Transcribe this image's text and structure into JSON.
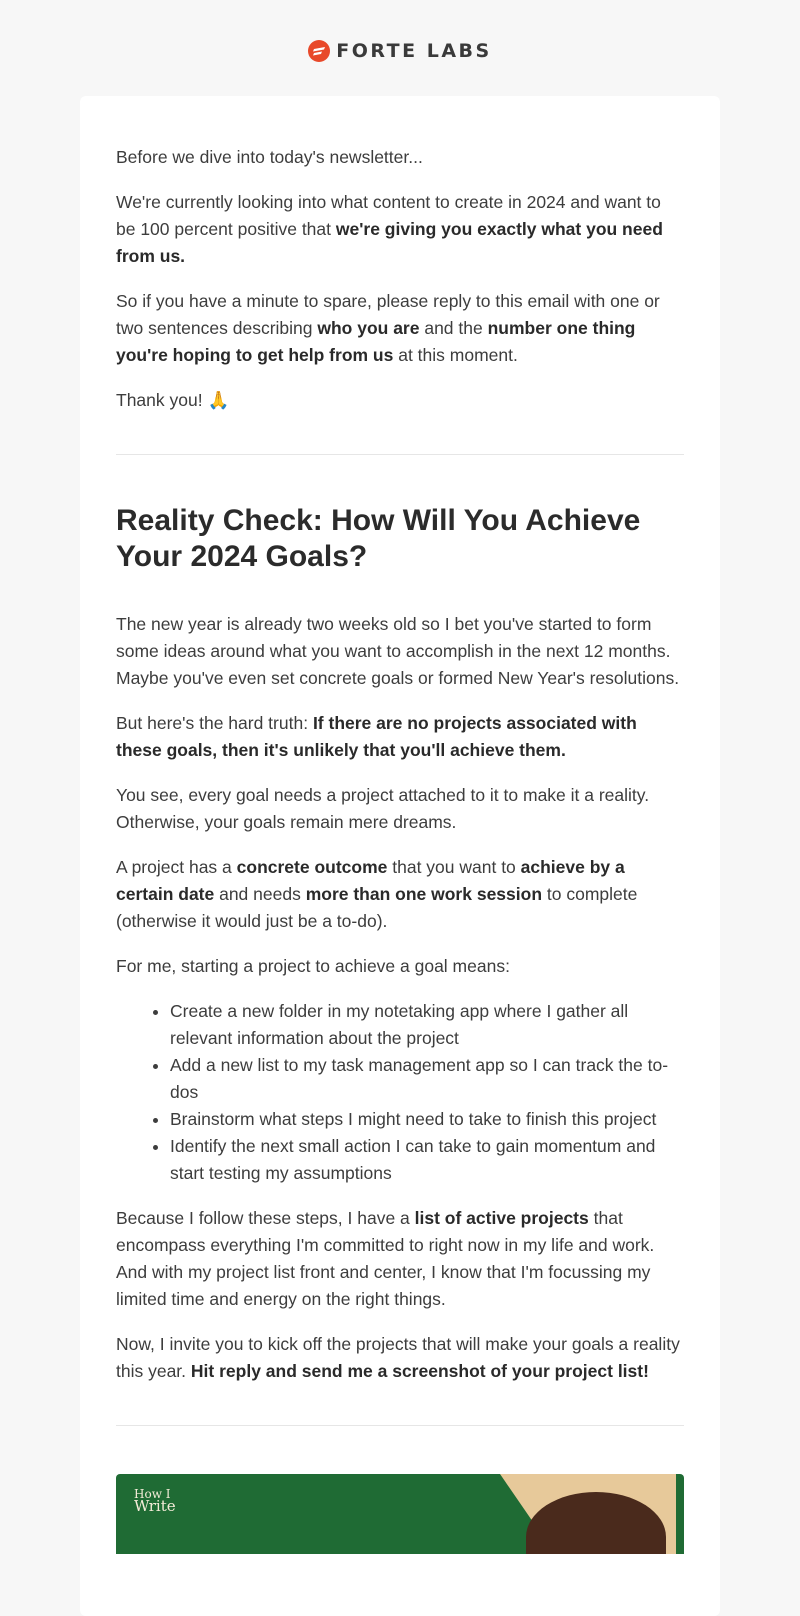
{
  "brand": {
    "name": "FORTE LABS",
    "accent": "#e8492a"
  },
  "intro": {
    "p1": "Before we dive into today's newsletter...",
    "p2_a": "We're currently looking into what content to create in 2024 and want to be 100 percent positive that ",
    "p2_b": "we're giving you exactly what you need from us.",
    "p3_a": "So if you have a minute to spare, please reply to this email with one or two sentences describing ",
    "p3_b": "who you are",
    "p3_c": " and the ",
    "p3_d": "number one thing you're hoping to get help from us",
    "p3_e": " at this moment.",
    "p4": "Thank you! 🙏"
  },
  "article": {
    "title": "Reality Check: How Will You Achieve Your 2024 Goals?",
    "p1": "The new year is already two weeks old so I bet you've started to form some ideas around what you want to accomplish in the next 12 months. Maybe you've even set concrete goals or formed New Year's resolutions.",
    "p2_a": "But here's the hard truth: ",
    "p2_b": "If there are no projects associated with these goals, then it's unlikely that you'll achieve them.",
    "p3": "You see, every goal needs a project attached to it to make it a reality. Otherwise, your goals remain mere dreams.",
    "p4_a": "A project has a ",
    "p4_b": "concrete outcome",
    "p4_c": " that you want to ",
    "p4_d": "achieve by a certain date",
    "p4_e": " and needs ",
    "p4_f": "more than one work session",
    "p4_g": " to complete (otherwise it would just be a to-do).",
    "p5": "For me, starting a project to achieve a goal means:",
    "list": [
      "Create a new folder in my notetaking app where I gather all relevant information about the project",
      "Add a new list to my task management app so I can track the to-dos",
      "Brainstorm what steps I might need to take to finish this project",
      "Identify the next small action I can take to gain momentum and start testing my assumptions"
    ],
    "p6_a": "Because I follow these steps, I have a ",
    "p6_b": "list of active projects",
    "p6_c": " that encompass everything I'm committed to right now in my life and work. And with my project list front and center, I know that I'm focussing my limited time and energy on the right things.",
    "p7_a": "Now, I invite you to kick off the projects that will make your goals a reality this year. ",
    "p7_b": "Hit reply and send me a screenshot of your project list!"
  },
  "promo": {
    "line1": "How I",
    "line2": "Write"
  }
}
